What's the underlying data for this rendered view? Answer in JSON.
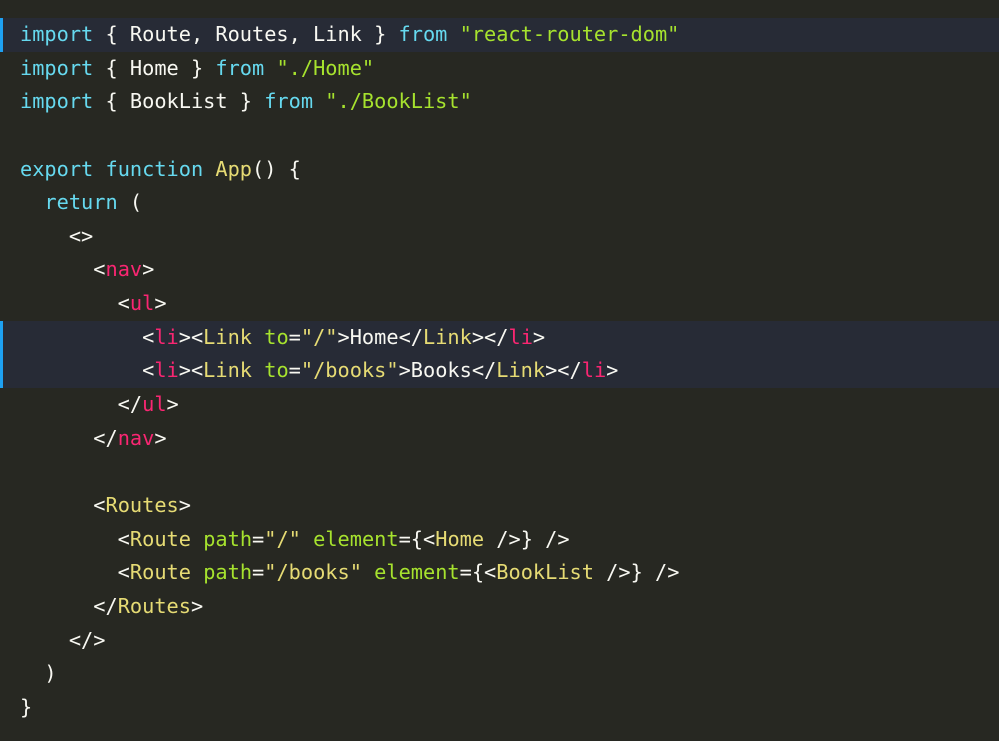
{
  "colors": {
    "background": "#272822",
    "highlight": "#272b36",
    "gutter_marker": "#1ea1f2",
    "keyword": "#66d9ef",
    "string": "#a6e22e",
    "tag": "#f92672",
    "component": "#e6db74",
    "attribute": "#a6e22e"
  },
  "highlighted_lines": [
    1,
    10,
    11
  ],
  "lines": [
    [
      [
        "kw",
        "import"
      ],
      [
        "txt",
        " { Route, Routes, Link } "
      ],
      [
        "kw",
        "from"
      ],
      [
        "txt",
        " "
      ],
      [
        "str",
        "\"react-router-dom\""
      ]
    ],
    [
      [
        "kw",
        "import"
      ],
      [
        "txt",
        " { Home } "
      ],
      [
        "kw",
        "from"
      ],
      [
        "txt",
        " "
      ],
      [
        "str",
        "\"./Home\""
      ]
    ],
    [
      [
        "kw",
        "import"
      ],
      [
        "txt",
        " { BookList } "
      ],
      [
        "kw",
        "from"
      ],
      [
        "txt",
        " "
      ],
      [
        "str",
        "\"./BookList\""
      ]
    ],
    [],
    [
      [
        "kw",
        "export"
      ],
      [
        "txt",
        " "
      ],
      [
        "kw",
        "function"
      ],
      [
        "txt",
        " "
      ],
      [
        "fn",
        "App"
      ],
      [
        "txt",
        "() {"
      ]
    ],
    [
      [
        "txt",
        "  "
      ],
      [
        "kw",
        "return"
      ],
      [
        "txt",
        " ("
      ]
    ],
    [
      [
        "txt",
        "    <>"
      ]
    ],
    [
      [
        "txt",
        "      <"
      ],
      [
        "tag",
        "nav"
      ],
      [
        "txt",
        ">"
      ]
    ],
    [
      [
        "txt",
        "        <"
      ],
      [
        "tag",
        "ul"
      ],
      [
        "txt",
        ">"
      ]
    ],
    [
      [
        "txt",
        "          <"
      ],
      [
        "tag",
        "li"
      ],
      [
        "txt",
        "><"
      ],
      [
        "comp",
        "Link"
      ],
      [
        "txt",
        " "
      ],
      [
        "attr",
        "to"
      ],
      [
        "txt",
        "="
      ],
      [
        "attrstr",
        "\"/\""
      ],
      [
        "txt",
        ">Home</"
      ],
      [
        "comp",
        "Link"
      ],
      [
        "txt",
        "></"
      ],
      [
        "tag",
        "li"
      ],
      [
        "txt",
        ">"
      ]
    ],
    [
      [
        "txt",
        "          <"
      ],
      [
        "tag",
        "li"
      ],
      [
        "txt",
        "><"
      ],
      [
        "comp",
        "Link"
      ],
      [
        "txt",
        " "
      ],
      [
        "attr",
        "to"
      ],
      [
        "txt",
        "="
      ],
      [
        "attrstr",
        "\"/books\""
      ],
      [
        "txt",
        ">Books</"
      ],
      [
        "comp",
        "Link"
      ],
      [
        "txt",
        "></"
      ],
      [
        "tag",
        "li"
      ],
      [
        "txt",
        ">"
      ]
    ],
    [
      [
        "txt",
        "        </"
      ],
      [
        "tag",
        "ul"
      ],
      [
        "txt",
        ">"
      ]
    ],
    [
      [
        "txt",
        "      </"
      ],
      [
        "tag",
        "nav"
      ],
      [
        "txt",
        ">"
      ]
    ],
    [],
    [
      [
        "txt",
        "      <"
      ],
      [
        "comp",
        "Routes"
      ],
      [
        "txt",
        ">"
      ]
    ],
    [
      [
        "txt",
        "        <"
      ],
      [
        "comp",
        "Route"
      ],
      [
        "txt",
        " "
      ],
      [
        "attr",
        "path"
      ],
      [
        "txt",
        "="
      ],
      [
        "attrstr",
        "\"/\""
      ],
      [
        "txt",
        " "
      ],
      [
        "attr",
        "element"
      ],
      [
        "txt",
        "={<"
      ],
      [
        "comp",
        "Home"
      ],
      [
        "txt",
        " />} />"
      ]
    ],
    [
      [
        "txt",
        "        <"
      ],
      [
        "comp",
        "Route"
      ],
      [
        "txt",
        " "
      ],
      [
        "attr",
        "path"
      ],
      [
        "txt",
        "="
      ],
      [
        "attrstr",
        "\"/books\""
      ],
      [
        "txt",
        " "
      ],
      [
        "attr",
        "element"
      ],
      [
        "txt",
        "={<"
      ],
      [
        "comp",
        "BookList"
      ],
      [
        "txt",
        " />} />"
      ]
    ],
    [
      [
        "txt",
        "      </"
      ],
      [
        "comp",
        "Routes"
      ],
      [
        "txt",
        ">"
      ]
    ],
    [
      [
        "txt",
        "    </>"
      ]
    ],
    [
      [
        "txt",
        "  )"
      ]
    ],
    [
      [
        "txt",
        "}"
      ]
    ]
  ]
}
